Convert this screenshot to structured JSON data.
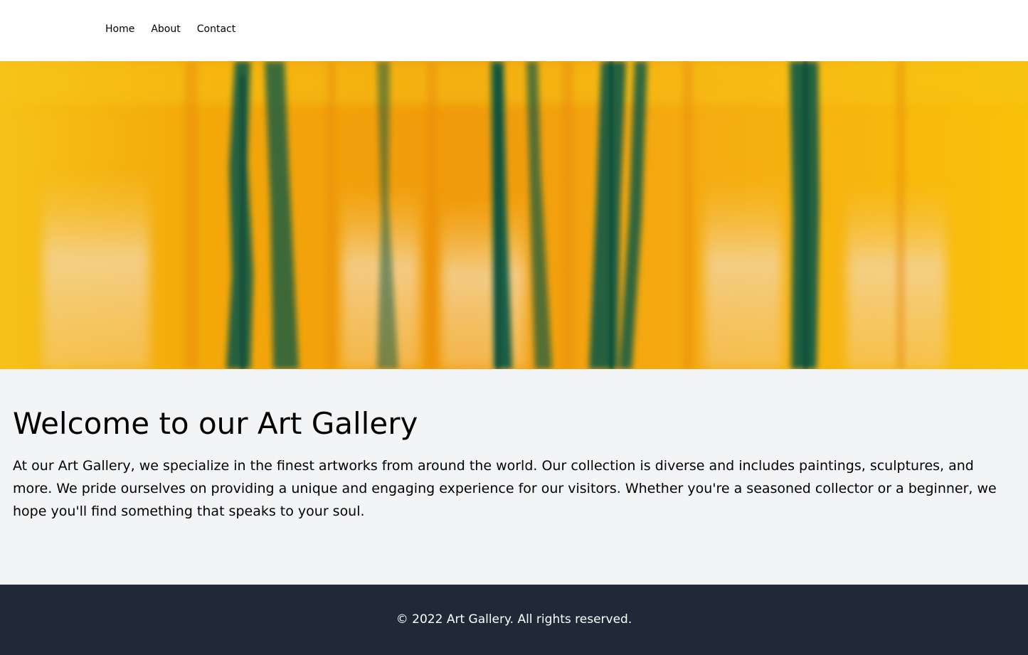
{
  "nav": {
    "items": [
      {
        "label": "Home"
      },
      {
        "label": "About"
      },
      {
        "label": "Contact"
      }
    ]
  },
  "hero": {
    "image": "abstract-yellow-green-painting"
  },
  "main": {
    "title": "Welcome to our Art Gallery",
    "body": "At our Art Gallery, we specialize in the finest artworks from around the world. Our collection is diverse and includes paintings, sculptures, and more. We pride ourselves on providing a unique and engaging experience for our visitors. Whether you're a seasoned collector or a beginner, we hope you'll find something that speaks to your soul."
  },
  "footer": {
    "text": "© 2022 Art Gallery. All rights reserved."
  },
  "colors": {
    "page_bg": "#f3f4f6",
    "nav_bg": "#ffffff",
    "footer_bg": "#1f2937",
    "hero_yellow": "#f7b500",
    "hero_green": "#0f5a45"
  }
}
